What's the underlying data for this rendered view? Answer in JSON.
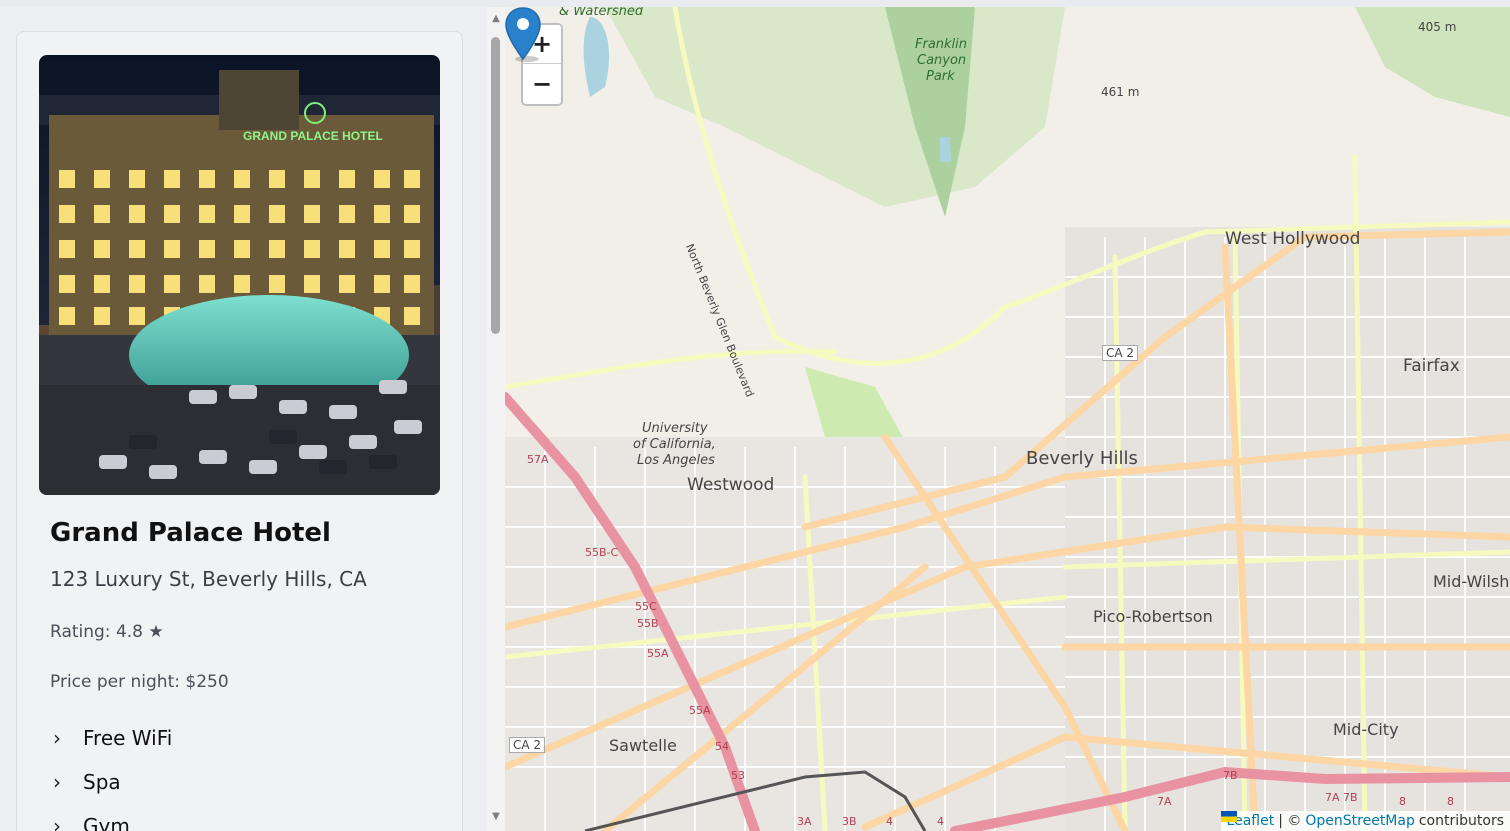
{
  "hotel": {
    "name": "Grand Palace Hotel",
    "address": "123 Luxury St, Beverly Hills, CA",
    "rating": "Rating: 4.8 ★",
    "price": "Price per night: $250",
    "photo_sign": "GRAND PALACE HOTEL",
    "amenities": [
      {
        "label": "Free WiFi"
      },
      {
        "label": "Spa"
      },
      {
        "label": "Gym"
      }
    ]
  },
  "icons": {
    "chevron": "chevron-right-icon",
    "marker": "map-marker-icon",
    "scroll_up": "scroll-up-arrow-icon",
    "scroll_down": "scroll-down-arrow-icon"
  },
  "map": {
    "zoom_in": "+",
    "zoom_out": "−",
    "labels": {
      "west_hollywood": "West Hollywood",
      "fairfax": "Fairfax",
      "beverly_hills": "Beverly Hills",
      "westwood": "Westwood",
      "ucla_1": "University",
      "ucla_2": "of California,",
      "ucla_3": "Los Angeles",
      "pico_robertson": "Pico-Robertson",
      "mid_wilshire": "Mid-Wilsh",
      "mid_city": "Mid-City",
      "sawtelle": "Sawtelle",
      "franklin_1": "Franklin",
      "franklin_2": "Canyon",
      "franklin_3": "Park",
      "watershed": "& Watershed",
      "elev_461": "461 m",
      "elev_405": "405 m",
      "ca2_a": "CA 2",
      "ca2_b": "CA 2",
      "beverly_glen": "North Beverly Glen Boulevard",
      "exit_57a": "57A",
      "exit_55bc": "55B-C",
      "exit_55c": "55C",
      "exit_55b": "55B",
      "exit_55a": "55A",
      "exit_55a2": "55A",
      "exit_54": "54",
      "exit_53": "53",
      "exit_3a": "3A",
      "exit_3b": "3B",
      "exit_4a": "4",
      "exit_4b": "4",
      "exit_7a": "7A",
      "exit_7b": "7B",
      "exit_7b2": "7A 7B",
      "exit_8": "8",
      "exit_8b": "8"
    },
    "attribution": {
      "leaflet": "Leaflet",
      "separator": "| ©",
      "osm": "OpenStreetMap",
      "suffix": "contributors"
    }
  },
  "colors": {
    "motorway": "#e892a2",
    "primary": "#fcd6a4",
    "secondary": "#f7fabf",
    "park": "#cdebb0",
    "forest": "#add19e",
    "land": "#f2efe9",
    "residential": "#e0dfdf",
    "water": "#aad3df",
    "marker": "#2a81cb"
  }
}
